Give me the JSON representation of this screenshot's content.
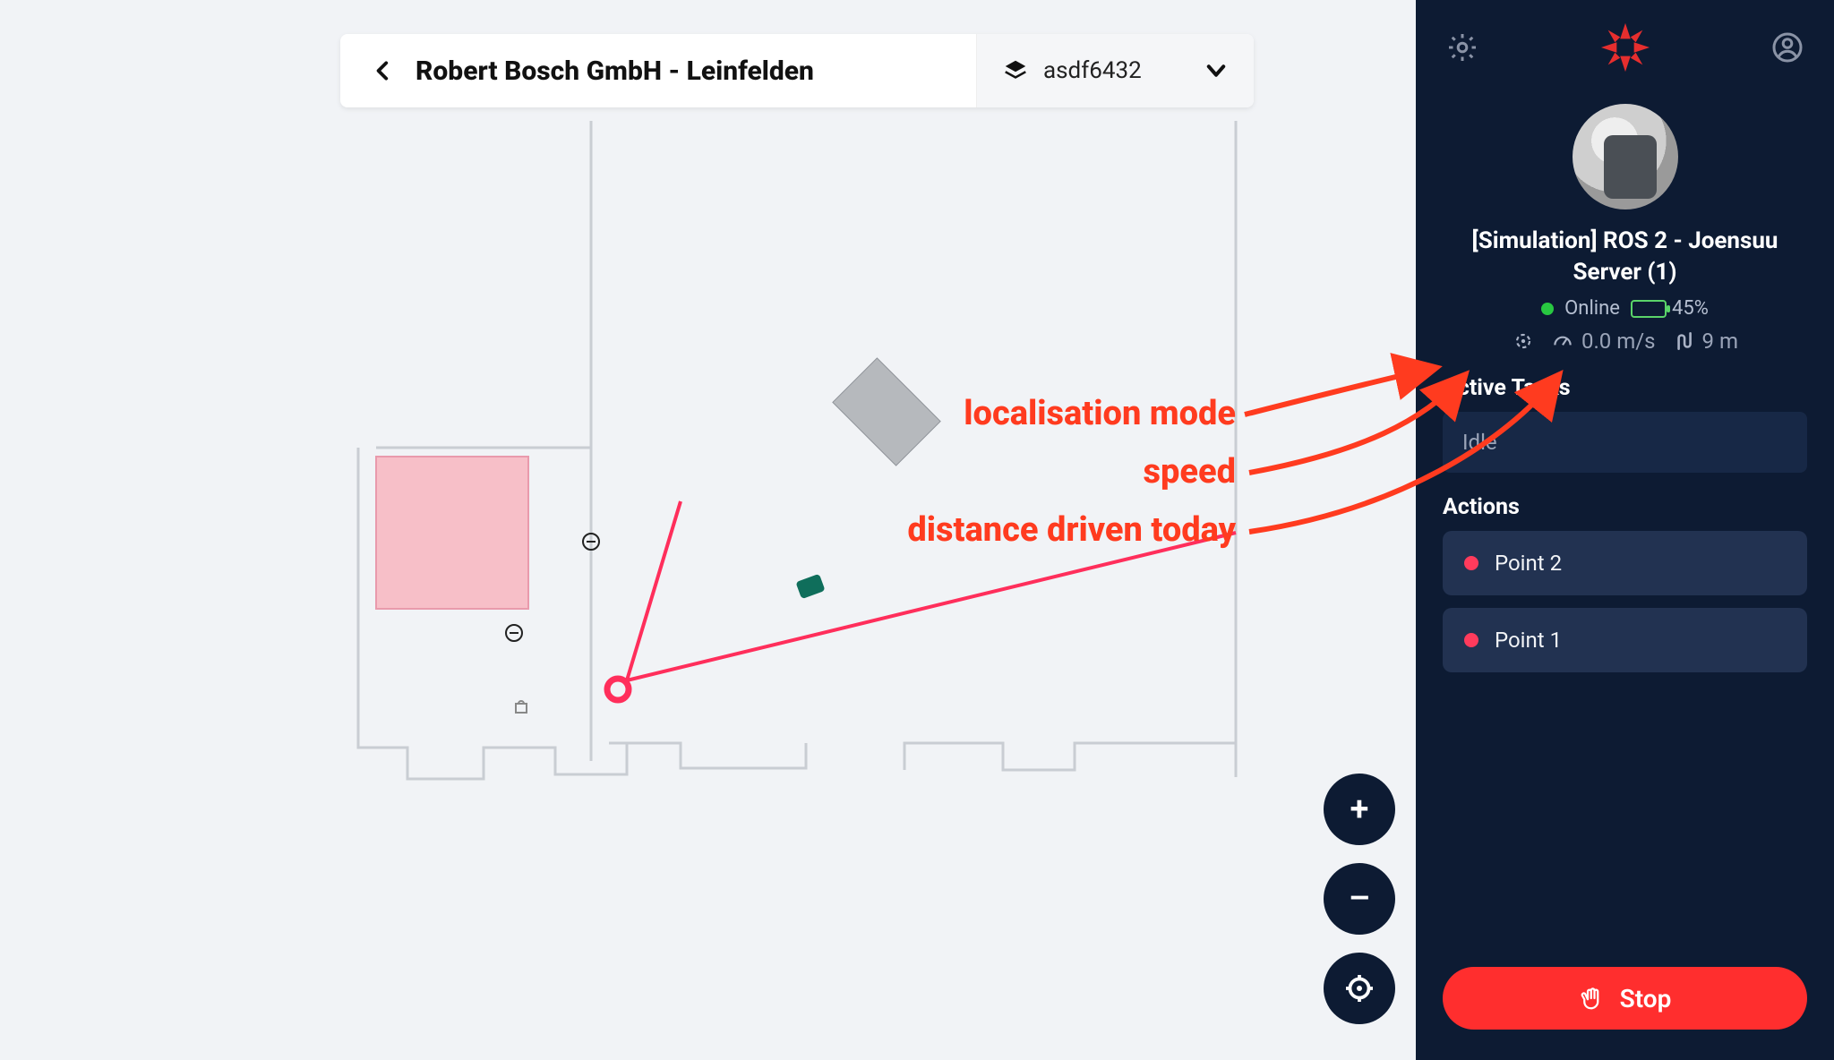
{
  "header": {
    "title": "Robert Bosch GmbH - Leinfelden",
    "map_selector": "asdf6432"
  },
  "sidebar": {
    "robot_name": "[Simulation] ROS 2 - Joensuu Server (1)",
    "status_label": "Online",
    "battery_pct": "45%",
    "battery_fill": 45,
    "speed": "0.0 m/s",
    "distance": "9 m",
    "active_tasks_heading": "Active Tasks",
    "task_state": "Idle",
    "actions_heading": "Actions",
    "actions": [
      "Point 2",
      "Point 1"
    ],
    "stop_label": "Stop"
  },
  "zoom": {
    "in": "+",
    "out": "–"
  },
  "annotations": {
    "loc_mode": "localisation mode",
    "speed": "speed",
    "distance": "distance driven today"
  }
}
